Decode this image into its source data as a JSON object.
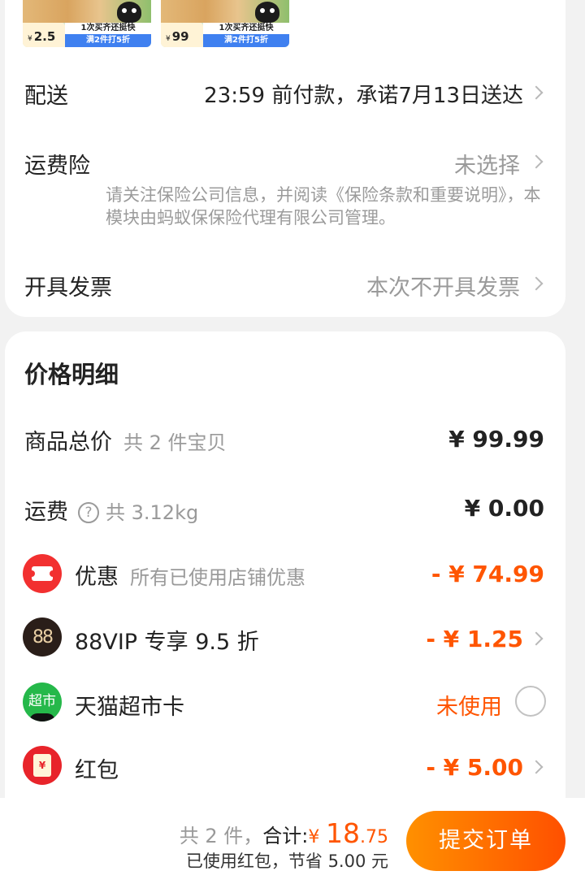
{
  "products": [
    {
      "price_symbol": "¥",
      "price": "2.5",
      "promo_line1": "1次买齐还挺快",
      "promo_line2": "满2件打5折"
    },
    {
      "price_symbol": "¥",
      "price": "99",
      "promo_line1": "1次买齐还挺快",
      "promo_line2": "满2件打5折"
    }
  ],
  "delivery": {
    "label": "配送",
    "value": "23:59 前付款，承诺7月13日送达"
  },
  "shipping_insurance": {
    "label": "运费险",
    "value": "未选择",
    "note": "请关注保险公司信息，并阅读《保险条款和重要说明》，本模块由蚂蚁保保险代理有限公司管理。"
  },
  "invoice": {
    "label": "开具发票",
    "value": "本次不开具发票"
  },
  "price_detail": {
    "title": "价格明细",
    "goods_total": {
      "label": "商品总价",
      "sub": "共 2 件宝贝",
      "amount": "¥ 99.99"
    },
    "freight": {
      "label": "运费",
      "help_icon_text": "?",
      "sub": "共 3.12kg",
      "amount": "¥ 0.00"
    },
    "discount": {
      "label": "优惠",
      "sub": "所有已使用店铺优惠",
      "amount": "- ¥ 74.99"
    },
    "vip": {
      "icon_text": "88",
      "label": "88VIP 专享 9.5 折",
      "amount": "- ¥ 1.25"
    },
    "market_card": {
      "icon_text": "超市",
      "label": "天猫超市卡",
      "status": "未使用"
    },
    "red_packet": {
      "icon_text": "¥",
      "label": "红包",
      "amount": "- ¥ 5.00"
    }
  },
  "footer": {
    "count": "共 2 件，",
    "total_label": "合计:",
    "currency": "¥",
    "total_integer": "18",
    "total_decimal": ".75",
    "saving_note": "已使用红包，节省 5.00 元",
    "submit_label": "提交订单"
  },
  "colors": {
    "accent": "#ff5500",
    "submit_start": "#ff9000",
    "submit_end": "#ff5000"
  }
}
